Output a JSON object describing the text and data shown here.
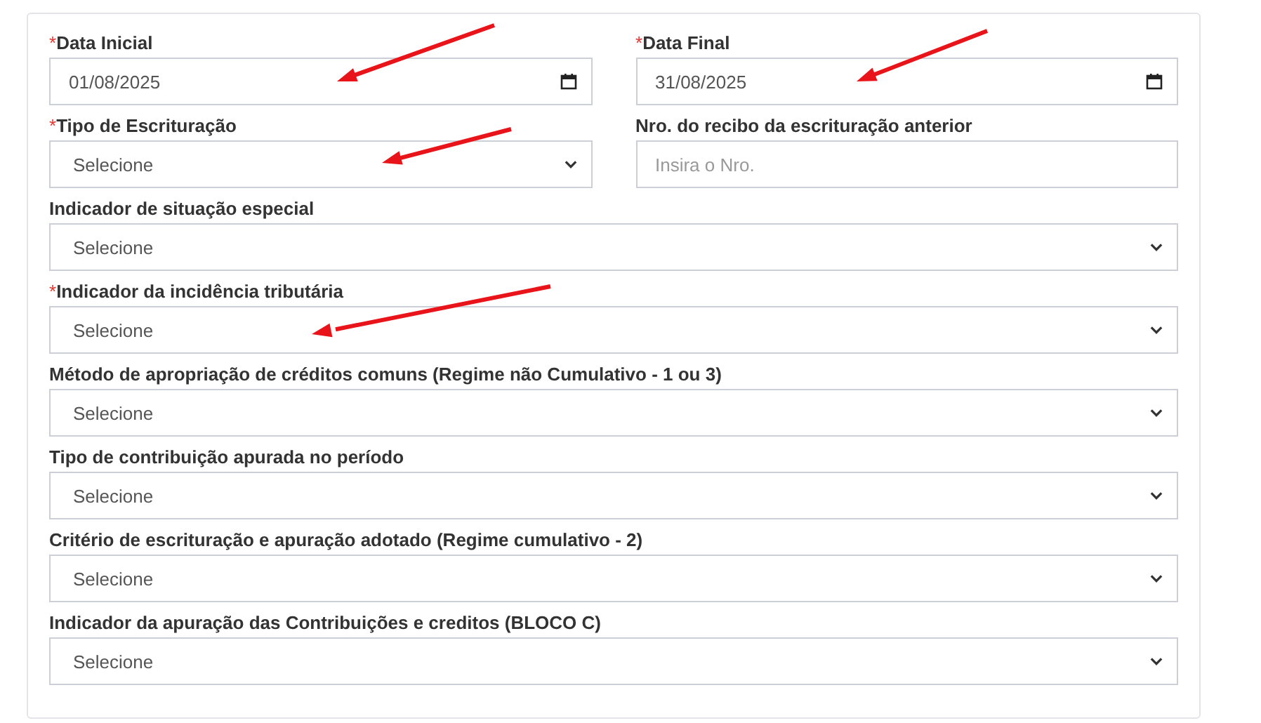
{
  "form": {
    "rows": [
      [
        {
          "label": "Data Inicial",
          "asterisk": "*",
          "kind": "date",
          "value": "01/08/2025"
        },
        {
          "label": "Data Final",
          "asterisk": "*",
          "kind": "date",
          "value": "31/08/2025"
        }
      ],
      [
        {
          "label": "Tipo de Escrituração",
          "asterisk": "*",
          "kind": "select",
          "value": "Selecione"
        },
        {
          "label": "Nro. do recibo da escrituração anterior",
          "kind": "text",
          "placeholder": "Insira o Nro."
        }
      ],
      [
        {
          "label": "Indicador de situação especial",
          "kind": "select",
          "value": "Selecione"
        }
      ],
      [
        {
          "label": "Indicador da incidência tributária",
          "asterisk": "*",
          "kind": "select",
          "value": "Selecione"
        }
      ],
      [
        {
          "label": "Método de apropriação de créditos comuns (Regime não Cumulativo - 1 ou 3)",
          "kind": "select",
          "value": "Selecione"
        }
      ],
      [
        {
          "label": "Tipo de contribuição apurada no período",
          "kind": "select",
          "value": "Selecione"
        }
      ],
      [
        {
          "label": "Critério de escrituração e apuração adotado (Regime cumulativo - 2)",
          "kind": "select",
          "value": "Selecione"
        }
      ],
      [
        {
          "label": "Indicador da apuração das Contribuições e creditos (BLOCO C)",
          "kind": "select",
          "value": "Selecione"
        }
      ]
    ]
  }
}
